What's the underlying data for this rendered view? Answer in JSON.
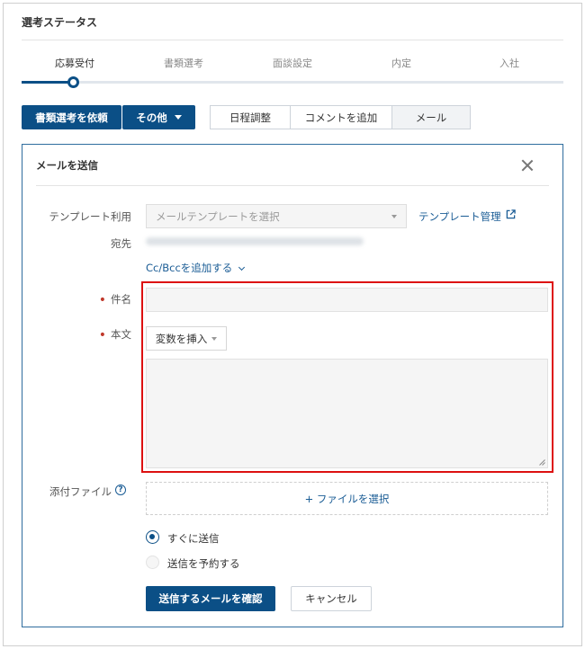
{
  "status": {
    "title": "選考ステータス",
    "steps": [
      "応募受付",
      "書類選考",
      "面談設定",
      "内定",
      "入社"
    ],
    "active_step": 0
  },
  "actions": {
    "request_docs": "書類選考を依頼",
    "other": "その他",
    "tabs": [
      "日程調整",
      "コメントを追加",
      "メール"
    ],
    "active_tab": 2
  },
  "mail_panel": {
    "title": "メールを送信",
    "template_label": "テンプレート利用",
    "template_placeholder": "メールテンプレートを選択",
    "template_manage": "テンプレート管理",
    "to_label": "宛先",
    "cc_bcc": "Cc/Bccを追加する",
    "subject_label": "件名",
    "subject_value": "",
    "body_label": "本文",
    "insert_variable": "変数を挿入",
    "body_value": "",
    "attach_label": "添付ファイル",
    "file_select": "+ ファイルを選択",
    "send_now": "すぐに送信",
    "schedule_send": "送信を予約する",
    "confirm_button": "送信するメールを確認",
    "cancel_button": "キャンセル"
  },
  "colors": {
    "primary": "#0b4f86",
    "link": "#1a5c95",
    "highlight": "#dd1111",
    "panel_border": "#2f6d9e"
  }
}
